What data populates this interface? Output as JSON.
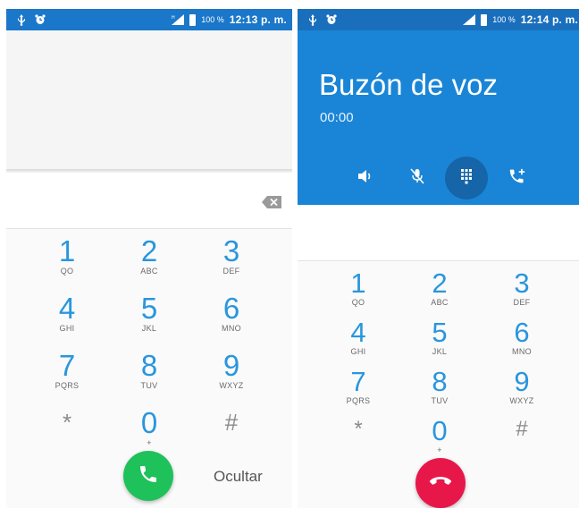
{
  "left_phone": {
    "status": {
      "battery": "100 %",
      "time": "12:13 p. m."
    },
    "keys": [
      {
        "num": "1",
        "letters": "QO"
      },
      {
        "num": "2",
        "letters": "ABC"
      },
      {
        "num": "3",
        "letters": "DEF"
      },
      {
        "num": "4",
        "letters": "GHI"
      },
      {
        "num": "5",
        "letters": "JKL"
      },
      {
        "num": "6",
        "letters": "MNO"
      },
      {
        "num": "7",
        "letters": "PQRS"
      },
      {
        "num": "8",
        "letters": "TUV"
      },
      {
        "num": "9",
        "letters": "WXYZ"
      },
      {
        "num": "*",
        "letters": ""
      },
      {
        "num": "0",
        "letters": "+"
      },
      {
        "num": "#",
        "letters": ""
      }
    ],
    "hide_label": "Ocultar"
  },
  "right_phone": {
    "status": {
      "battery": "100 %",
      "time": "12:14 p. m."
    },
    "call_name": "Buzón de voz",
    "call_timer": "00:00",
    "keys": [
      {
        "num": "1",
        "letters": "QO"
      },
      {
        "num": "2",
        "letters": "ABC"
      },
      {
        "num": "3",
        "letters": "DEF"
      },
      {
        "num": "4",
        "letters": "GHI"
      },
      {
        "num": "5",
        "letters": "JKL"
      },
      {
        "num": "6",
        "letters": "MNO"
      },
      {
        "num": "7",
        "letters": "PQRS"
      },
      {
        "num": "8",
        "letters": "TUV"
      },
      {
        "num": "9",
        "letters": "WXYZ"
      },
      {
        "num": "*",
        "letters": ""
      },
      {
        "num": "0",
        "letters": "+"
      },
      {
        "num": "#",
        "letters": ""
      }
    ]
  },
  "colors": {
    "status_blue": "#1a77c9",
    "header_blue": "#1a85d6",
    "digit_blue": "#2996dd",
    "call_green": "#1fc15a",
    "hangup_red": "#e8174a"
  },
  "icons": {
    "status_left": [
      "usb-icon",
      "alarm-icon"
    ],
    "status_right": [
      "signal-icon",
      "battery-icon"
    ],
    "call_controls": [
      "speaker-icon",
      "mute-icon",
      "dialpad-icon",
      "add-call-icon"
    ],
    "dialer": [
      "backspace-icon",
      "phone-icon",
      "hangup-icon"
    ]
  }
}
